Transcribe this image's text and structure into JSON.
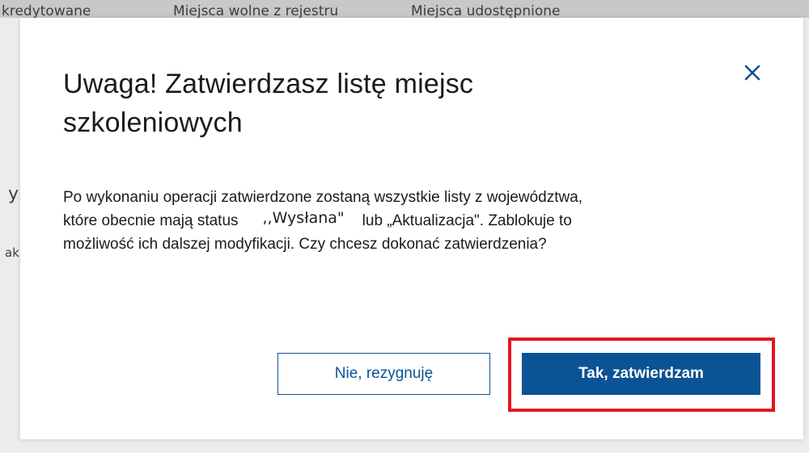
{
  "background": {
    "columns": [
      "kredytowane",
      "Miejsca wolne z rejestru",
      "Miejsca udostępnione"
    ],
    "fragments": [
      "y",
      "ak"
    ]
  },
  "modal": {
    "title": "Uwaga! Zatwierdzasz listę miejsc szkoleniowych",
    "close_icon": "close-icon",
    "body": {
      "line1": "Po wykonaniu operacji zatwierdzone zostaną wszystkie listy z województwa,",
      "line2_pre": "które obecnie mają status",
      "status": ",,Wysłana\"",
      "line2_post": "lub „Aktualizacja\". Zablokuje to",
      "line3": "możliwość ich dalszej modyfikacji. Czy chcesz dokonać zatwierdzenia?"
    },
    "cancel_label": "Nie, rezygnuję",
    "confirm_label": "Tak, zatwierdzam"
  },
  "colors": {
    "primary": "#0b5394",
    "highlight": "#e8141f",
    "text": "#1b1b1b"
  }
}
